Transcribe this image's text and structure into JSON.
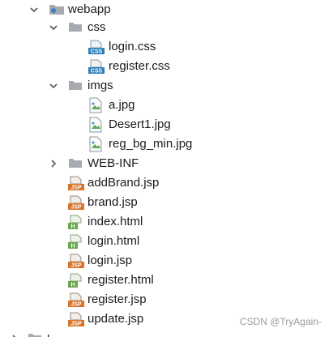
{
  "tree": {
    "webapp": {
      "label": "webapp",
      "icon": "web-folder-icon"
    },
    "css": {
      "label": "css",
      "children": [
        {
          "label": "login.css",
          "icon": "css-file-icon"
        },
        {
          "label": "register.css",
          "icon": "css-file-icon"
        }
      ]
    },
    "imgs": {
      "label": "imgs",
      "children": [
        {
          "label": "a.jpg",
          "icon": "image-file-icon"
        },
        {
          "label": "Desert1.jpg",
          "icon": "image-file-icon"
        },
        {
          "label": "reg_bg_min.jpg",
          "icon": "image-file-icon"
        }
      ]
    },
    "webinf": {
      "label": "WEB-INF",
      "icon": "folder-icon"
    },
    "files": [
      {
        "label": "addBrand.jsp",
        "icon": "jsp-file-icon"
      },
      {
        "label": "brand.jsp",
        "icon": "jsp-file-icon"
      },
      {
        "label": "index.html",
        "icon": "html-file-icon"
      },
      {
        "label": "login.html",
        "icon": "html-file-icon"
      },
      {
        "label": "login.jsp",
        "icon": "jsp-file-icon"
      },
      {
        "label": "register.html",
        "icon": "html-file-icon"
      },
      {
        "label": "register.jsp",
        "icon": "jsp-file-icon"
      },
      {
        "label": "update.jsp",
        "icon": "jsp-file-icon"
      }
    ],
    "partial": {
      "label": "b..."
    }
  },
  "icons": {
    "css_badge_text": "CSS",
    "jsp_badge_text": "JSP",
    "html_badge_text": "H",
    "css_color": "#2f7fb8",
    "jsp_color": "#d9742b",
    "html_color": "#6aa84f",
    "folder_color": "#9aa0a6"
  },
  "watermark": "CSDN @TryAgain-"
}
